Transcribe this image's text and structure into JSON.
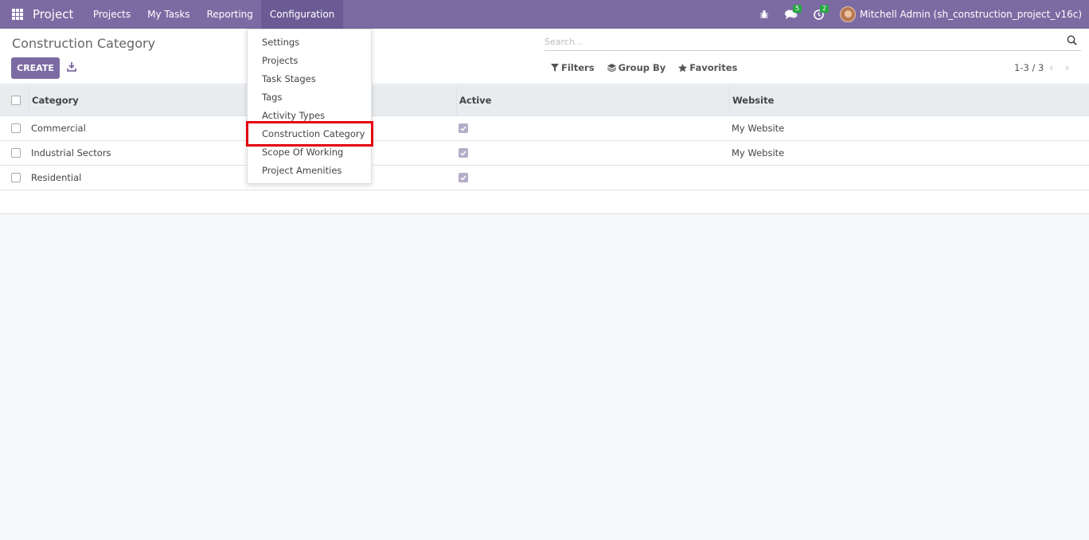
{
  "navbar": {
    "brand": "Project",
    "menu": [
      "Projects",
      "My Tasks",
      "Reporting",
      "Configuration"
    ],
    "messages_count": "5",
    "activities_count": "2",
    "user_name": "Mitchell Admin (sh_construction_project_v16c)"
  },
  "control_panel": {
    "title": "Construction Category",
    "create_label": "CREATE",
    "search_placeholder": "Search...",
    "filters_label": "Filters",
    "group_by_label": "Group By",
    "favorites_label": "Favorites",
    "pager": "1-3 / 3"
  },
  "table": {
    "columns": [
      "Category",
      "Active",
      "Website"
    ],
    "rows": [
      {
        "category": "Commercial",
        "active": true,
        "website": "My Website"
      },
      {
        "category": "Industrial Sectors",
        "active": true,
        "website": "My Website"
      },
      {
        "category": "Residential",
        "active": true,
        "website": ""
      }
    ]
  },
  "configuration_menu": {
    "items": [
      "Settings",
      "Projects",
      "Task Stages",
      "Tags",
      "Activity Types",
      "Construction Category",
      "Scope Of Working",
      "Project Amenities"
    ]
  },
  "colors": {
    "navbar": "#7c6ba3",
    "highlight": "#e3000f",
    "badge": "#28a745"
  }
}
